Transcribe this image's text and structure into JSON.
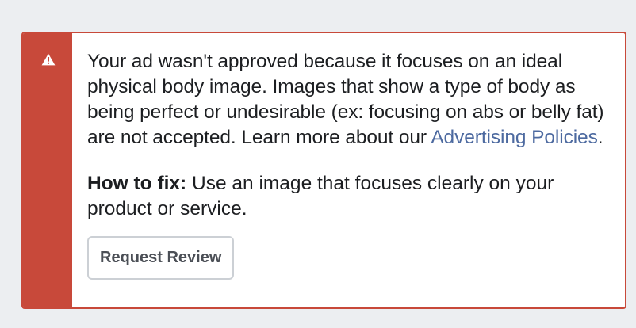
{
  "notice": {
    "icon": "warning-icon",
    "accent_color": "#c8493a",
    "link_color": "#4d6aa0",
    "message_before_link": " Your ad wasn't approved because it focuses on an ideal physical body image. Images that show a type of body as being perfect or undesirable (ex: focusing on abs or belly fat) are not accepted. Learn more about our ",
    "link_text": "Advertising Policies",
    "message_after_link": ".",
    "fix_label": "How to fix:",
    "fix_text": " Use an image that focuses clearly on your product or service.",
    "button_label": "Request Review"
  }
}
